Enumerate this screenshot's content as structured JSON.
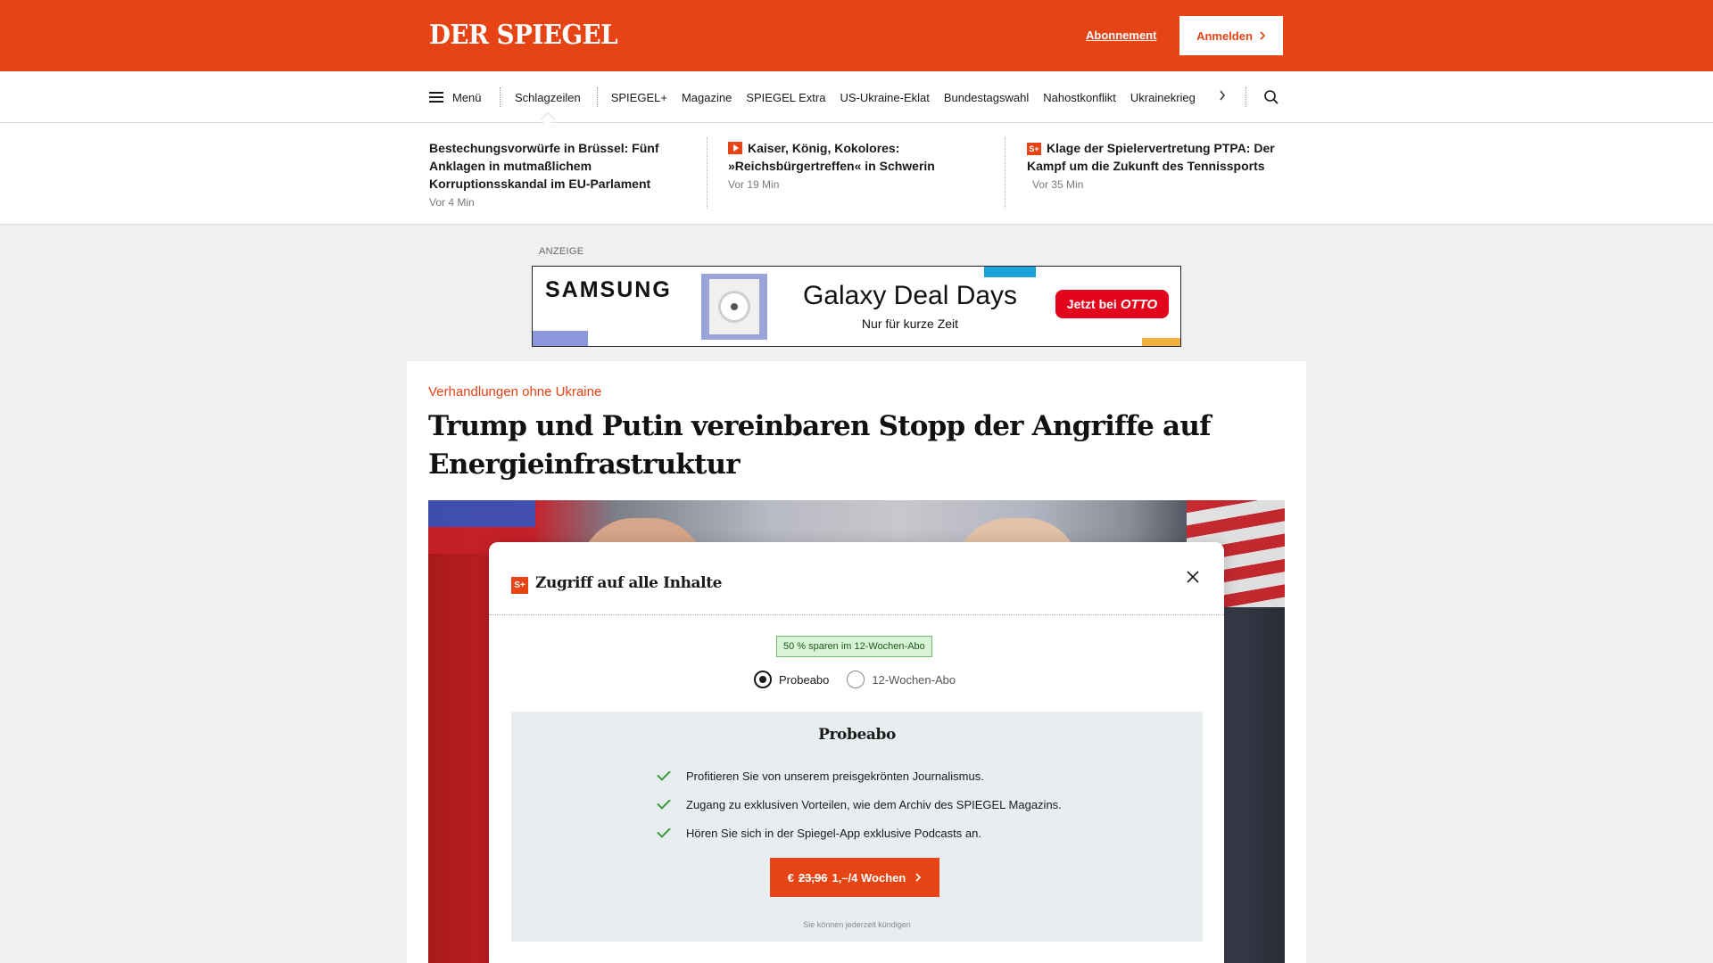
{
  "header": {
    "logo": "DER SPIEGEL",
    "subscription_link": "Abonnement",
    "login_button": "Anmelden",
    "brand_color": "#e64415"
  },
  "nav": {
    "menu_label": "Menü",
    "items": [
      "Schlagzeilen",
      "SPIEGEL+",
      "Magazine",
      "SPIEGEL Extra",
      "US-Ukraine-Eklat",
      "Bundestagswahl",
      "Nahostkonflikt",
      "Ukrainekrieg"
    ],
    "active_item": "Schlagzeilen"
  },
  "ticker": [
    {
      "title": "Bestechungsvorwürfe in Brüssel: Fünf Anklagen in mutmaßlichem Korruptionsskandal im EU-Parlament",
      "time": "Vor 4 Min",
      "badge": ""
    },
    {
      "title": "Kaiser, König, Kokolores: »Reichsbürgertreffen« in Schwerin",
      "time": "Vor 19 Min",
      "badge": "video-icon"
    },
    {
      "title": "Klage der Spielervertretung PTPA: Der Kampf um die Zukunft des Tennissports",
      "time": "Vor 35 Min",
      "badge": "spiegel-plus-icon"
    }
  ],
  "ad": {
    "label": "ANZEIGE",
    "brand": "SAMSUNG",
    "title": "Galaxy Deal Days",
    "subtitle": "Nur für kurze Zeit",
    "cta_prefix": "Jetzt bei",
    "cta_brand": "OTTO"
  },
  "article": {
    "kicker": "Verhandlungen ohne Ukraine",
    "headline": "Trump und Putin vereinbaren Stopp der Angriffe auf Energieinfrastruktur"
  },
  "paywall": {
    "badge": "S+",
    "title": "Zugriff auf alle Inhalte",
    "savings_note": "50 % sparen im 12-Wochen-Abo",
    "options": [
      {
        "label": "Probeabo",
        "selected": true
      },
      {
        "label": "12-Wochen-Abo",
        "selected": false
      }
    ],
    "plan_title": "Probeabo",
    "benefits": [
      "Profitieren Sie von unserem preisgekrönten Journalismus.",
      "Zugang zu exklusiven Vorteilen, wie dem Archiv des SPIEGEL Magazins.",
      "Hören Sie sich in der Spiegel-App exklusive Podcasts an."
    ],
    "price_currency": "€",
    "price_old": "23,96",
    "price_new": "1,–/4 Wochen",
    "cancel_note": "Sie können jederzeit kündigen"
  }
}
